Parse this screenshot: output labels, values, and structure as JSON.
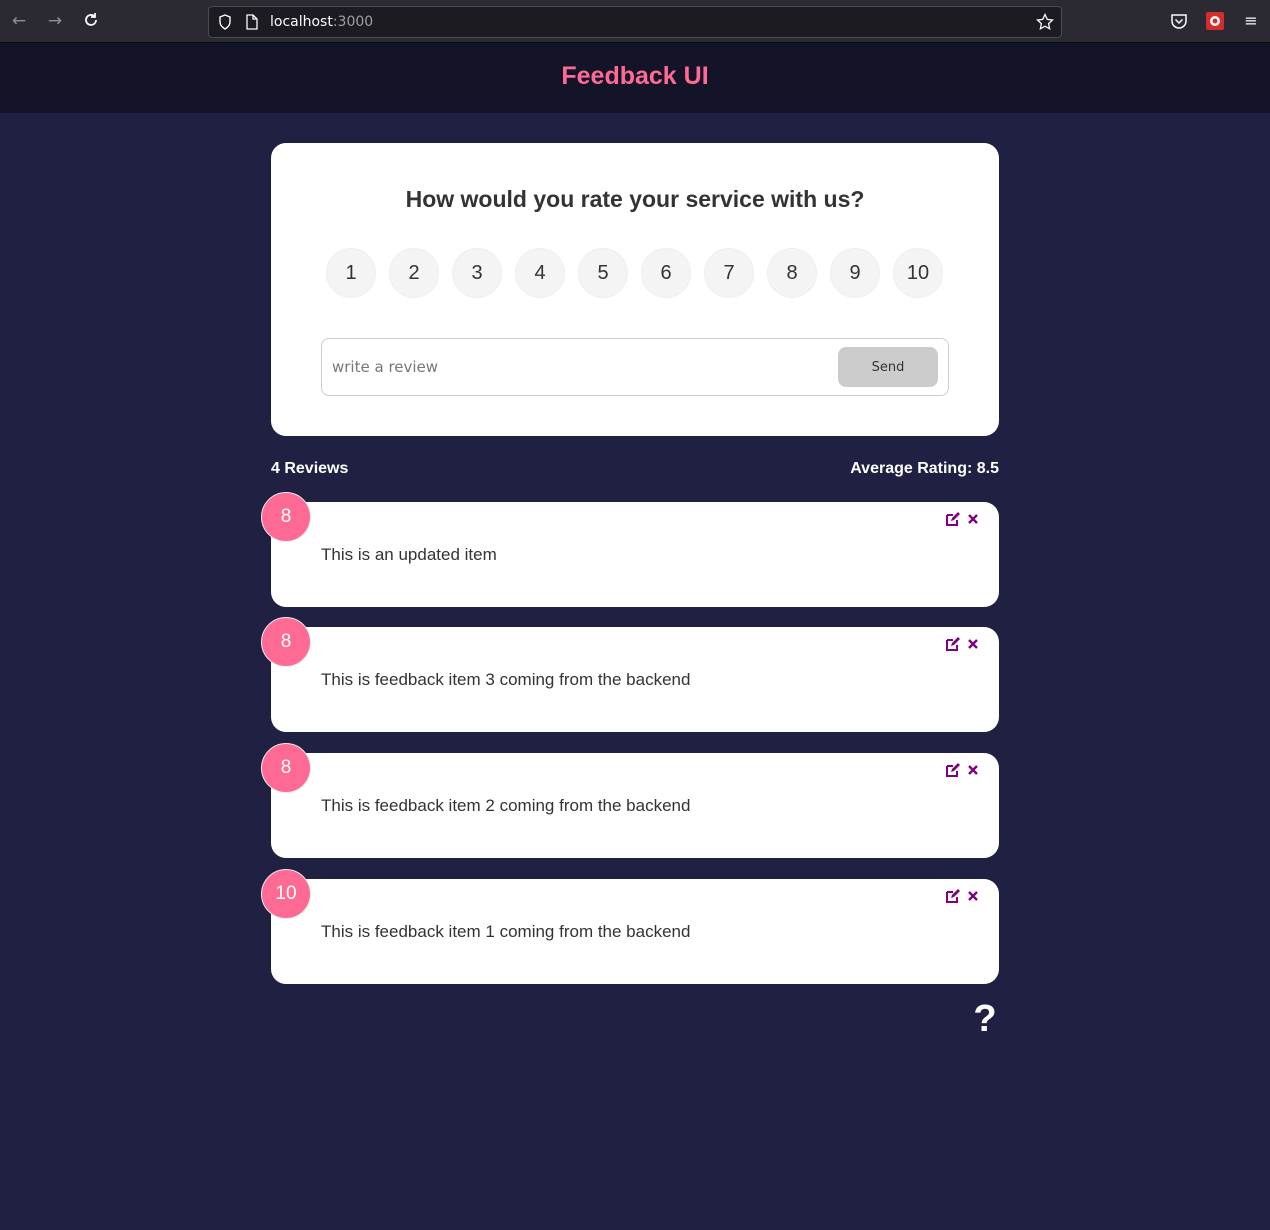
{
  "browser": {
    "url_host": "localhost",
    "url_port": ":3000",
    "back_icon": "arrow-left-icon",
    "forward_icon": "arrow-right-icon",
    "reload_icon": "reload-icon"
  },
  "header": {
    "title": "Feedback UI"
  },
  "rating_form": {
    "question": "How would you rate your service with us?",
    "options": [
      "1",
      "2",
      "3",
      "4",
      "5",
      "6",
      "7",
      "8",
      "9",
      "10"
    ],
    "input_placeholder": "write a review",
    "send_label": "Send"
  },
  "stats": {
    "reviews_label": "4 Reviews",
    "average_label": "Average Rating: 8.5"
  },
  "feedback": [
    {
      "rating": "8",
      "text": "This is an updated item"
    },
    {
      "rating": "8",
      "text": "This is feedback item 3 coming from the backend"
    },
    {
      "rating": "8",
      "text": "This is feedback item 2 coming from the backend"
    },
    {
      "rating": "10",
      "text": "This is feedback item 1 coming from the backend"
    }
  ],
  "about": {
    "label": "?"
  },
  "colors": {
    "background": "#202142",
    "header_bg": "#131428",
    "accent": "#ff6a95",
    "icon_purple": "#800080"
  }
}
